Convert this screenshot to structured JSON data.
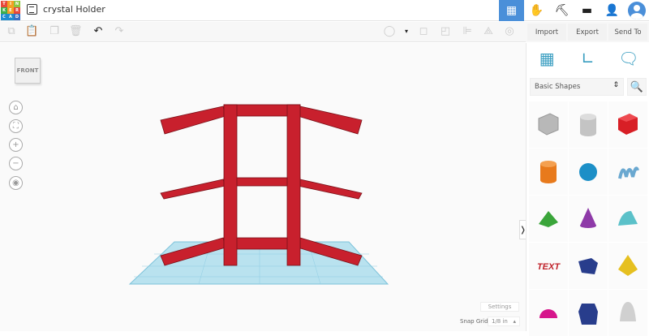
{
  "app": {
    "logo": [
      "T",
      "I",
      "N",
      "K",
      "E",
      "R",
      "C",
      "A",
      "D"
    ],
    "title": "crystal Holder"
  },
  "header": {
    "nav": [
      {
        "icon": "grid-icon",
        "active": true
      },
      {
        "icon": "hand-icon"
      },
      {
        "icon": "pickaxe-icon"
      },
      {
        "icon": "brick-icon"
      },
      {
        "icon": "add-user-icon"
      }
    ]
  },
  "actions": {
    "import": "Import",
    "export": "Export",
    "send_to": "Send To"
  },
  "viewport": {
    "front_label": "FRONT",
    "settings": "Settings",
    "snap_grid_label": "Snap Grid",
    "snap_grid_value": "1/8 in"
  },
  "panel": {
    "category": "Basic Shapes",
    "shapes": [
      {
        "name": "box-hole",
        "color": "#b8b8b8"
      },
      {
        "name": "cylinder-hole",
        "color": "#c4c4c4"
      },
      {
        "name": "box",
        "color": "#d81f26"
      },
      {
        "name": "cylinder",
        "color": "#e87a1c"
      },
      {
        "name": "sphere",
        "color": "#1c8fc7"
      },
      {
        "name": "scribble",
        "color": "#6aa8d0"
      },
      {
        "name": "roof",
        "color": "#3aa53a"
      },
      {
        "name": "cone",
        "color": "#8e3aa8"
      },
      {
        "name": "round-roof",
        "color": "#5bc1c9"
      },
      {
        "name": "text",
        "color": "#c0222a"
      },
      {
        "name": "wedge",
        "color": "#283d8c"
      },
      {
        "name": "pyramid",
        "color": "#e6c020"
      },
      {
        "name": "half-sphere",
        "color": "#d6168c"
      },
      {
        "name": "polygon",
        "color": "#283d8c"
      },
      {
        "name": "paraboloid",
        "color": "#d0d0d0"
      }
    ]
  }
}
